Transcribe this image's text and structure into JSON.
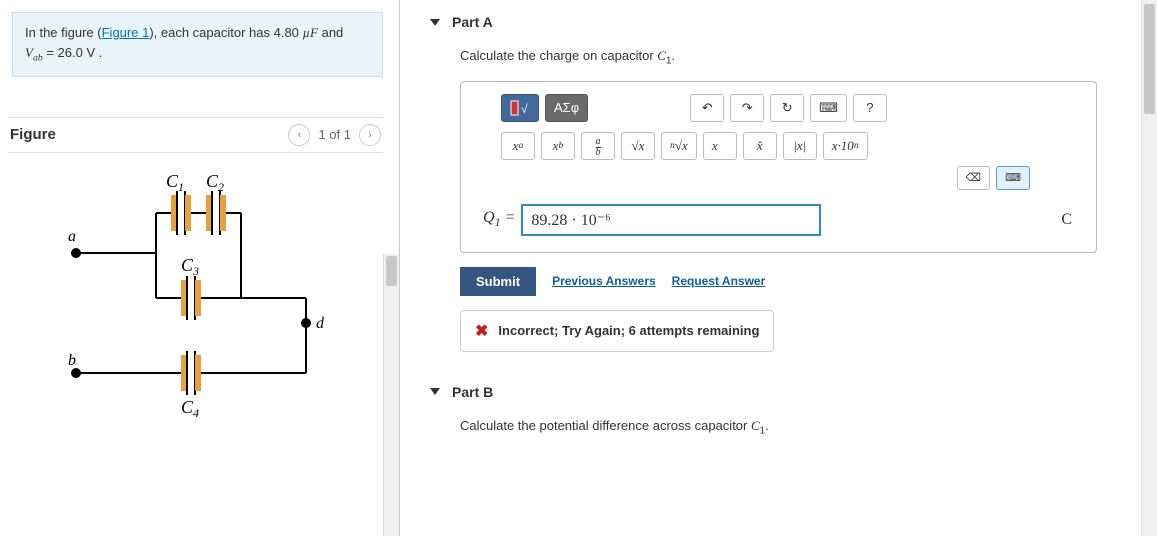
{
  "problem": {
    "prefix": "In the figure (",
    "figure_link": "Figure 1",
    "cap_value": "4.80",
    "cap_unit": "µF",
    "vab_label": "V",
    "vab_sub": "ab",
    "vab_value": "26.0",
    "vab_unit": "V"
  },
  "figure": {
    "title": "Figure",
    "nav_label": "1 of 1",
    "labels": {
      "c1": "C",
      "c2": "C",
      "c3": "C",
      "c4": "C",
      "a": "a",
      "b": "b",
      "d": "d"
    },
    "subs": {
      "c1": "1",
      "c2": "2",
      "c3": "3",
      "c4": "4"
    }
  },
  "partA": {
    "title": "Part A",
    "prompt_prefix": "Calculate the charge on capacitor ",
    "prompt_var": "C",
    "prompt_sub": "1",
    "toolbar": {
      "templates": "ΑΣφ",
      "help": "?"
    },
    "mathbtns": {
      "xa": "xᵃ",
      "xb": "xᵇ",
      "ab": "a/b",
      "sqrt": "√x",
      "nroot": "ⁿ√x",
      "vec": "x⃗",
      "hat": "x̂",
      "abs": "|x|",
      "sci": "x·10ⁿ"
    },
    "answer": {
      "var": "Q",
      "sub": "1",
      "value": "89.28 · 10⁻⁶",
      "unit": "C"
    },
    "actions": {
      "submit": "Submit",
      "previous": "Previous Answers",
      "request": "Request Answer"
    },
    "feedback": "Incorrect; Try Again; 6 attempts remaining"
  },
  "partB": {
    "title": "Part B",
    "prompt_prefix": "Calculate the potential difference across capacitor ",
    "prompt_var": "C",
    "prompt_sub": "1"
  }
}
